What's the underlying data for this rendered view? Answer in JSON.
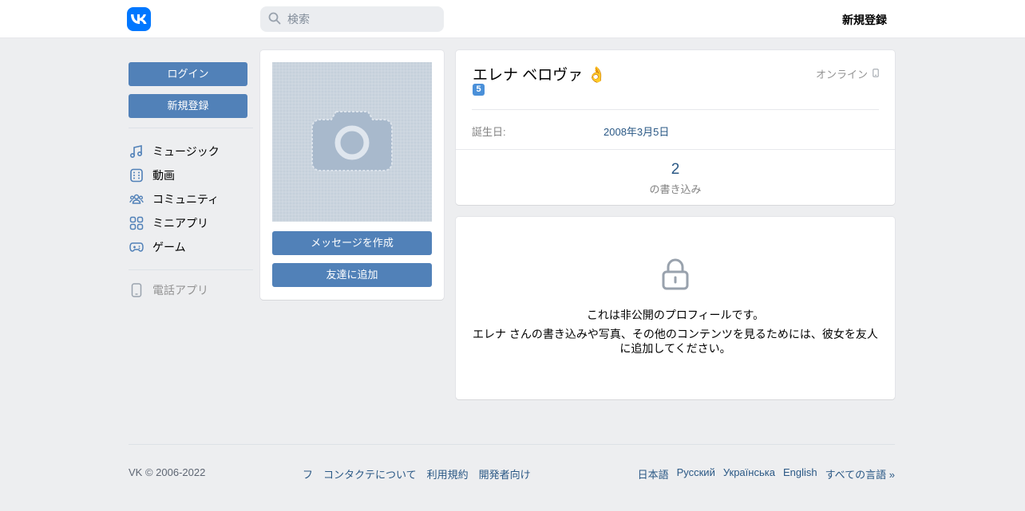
{
  "header": {
    "search_placeholder": "検索",
    "register_label": "新規登録"
  },
  "sidebar": {
    "login_label": "ログイン",
    "register_label": "新規登録",
    "items": [
      {
        "label": "ミュージック",
        "icon": "music-icon"
      },
      {
        "label": "動画",
        "icon": "video-icon"
      },
      {
        "label": "コミュニティ",
        "icon": "community-icon"
      },
      {
        "label": "ミニアプリ",
        "icon": "mini-apps-icon"
      },
      {
        "label": "ゲーム",
        "icon": "game-icon"
      }
    ],
    "phone_app_label": "電話アプリ"
  },
  "photo": {
    "message_button": "メッセージを作成",
    "add_friend_button": "友達に追加"
  },
  "profile": {
    "name": "エレナ ベロヴァ 👌",
    "status_emoji": "5",
    "online": "オンライン",
    "birthday_label": "誕生日:",
    "birthday_value": "2008年3月5日",
    "posts_count": "2",
    "posts_label": "の書き込み"
  },
  "private": {
    "title": "これは非公開のプロフィールです。",
    "text": "エレナ さんの書き込みや写真、その他のコンテンツを見るためには、彼女を友人に追加してください。"
  },
  "footer": {
    "copyright": "VK © 2006-2022",
    "links": [
      "フ",
      "コンタクテについて",
      "利用規約",
      "開発者向け"
    ],
    "languages": [
      "日本語",
      "Русский",
      "Українська",
      "English",
      "すべての言語 »"
    ]
  },
  "colors": {
    "brand": "#0077ff",
    "button": "#5181b8",
    "link": "#2a5885",
    "background": "#edeef0"
  }
}
